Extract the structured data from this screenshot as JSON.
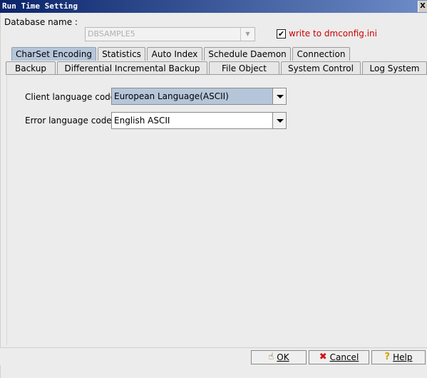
{
  "window": {
    "title": "Run Time Setting",
    "close_glyph": "X"
  },
  "database": {
    "label": "Database name :",
    "value": "DBSAMPLE5",
    "write_checkbox": {
      "checked": true,
      "label": "write to dmconfig.ini"
    }
  },
  "tabs_row1": [
    {
      "label": "CharSet Encoding",
      "active": true
    },
    {
      "label": "Statistics"
    },
    {
      "label": "Auto Index"
    },
    {
      "label": "Schedule Daemon"
    },
    {
      "label": "Connection"
    }
  ],
  "tabs_row2": [
    {
      "label": "Backup"
    },
    {
      "label": "Differential Incremental Backup"
    },
    {
      "label": "File Object"
    },
    {
      "label": "System Control"
    },
    {
      "label": "Log System"
    }
  ],
  "charset": {
    "client_label": "Client language code:",
    "client_value": "European Language(ASCII)",
    "error_label": "Error language code:",
    "error_value": "English ASCII"
  },
  "buttons": {
    "ok": "OK",
    "cancel": "Cancel",
    "help": "Help"
  },
  "icons": {
    "ok": "hand-pointer-icon",
    "cancel": "red-x-icon",
    "help": "question-mark-icon",
    "dropdown": "chevron-down-icon"
  }
}
